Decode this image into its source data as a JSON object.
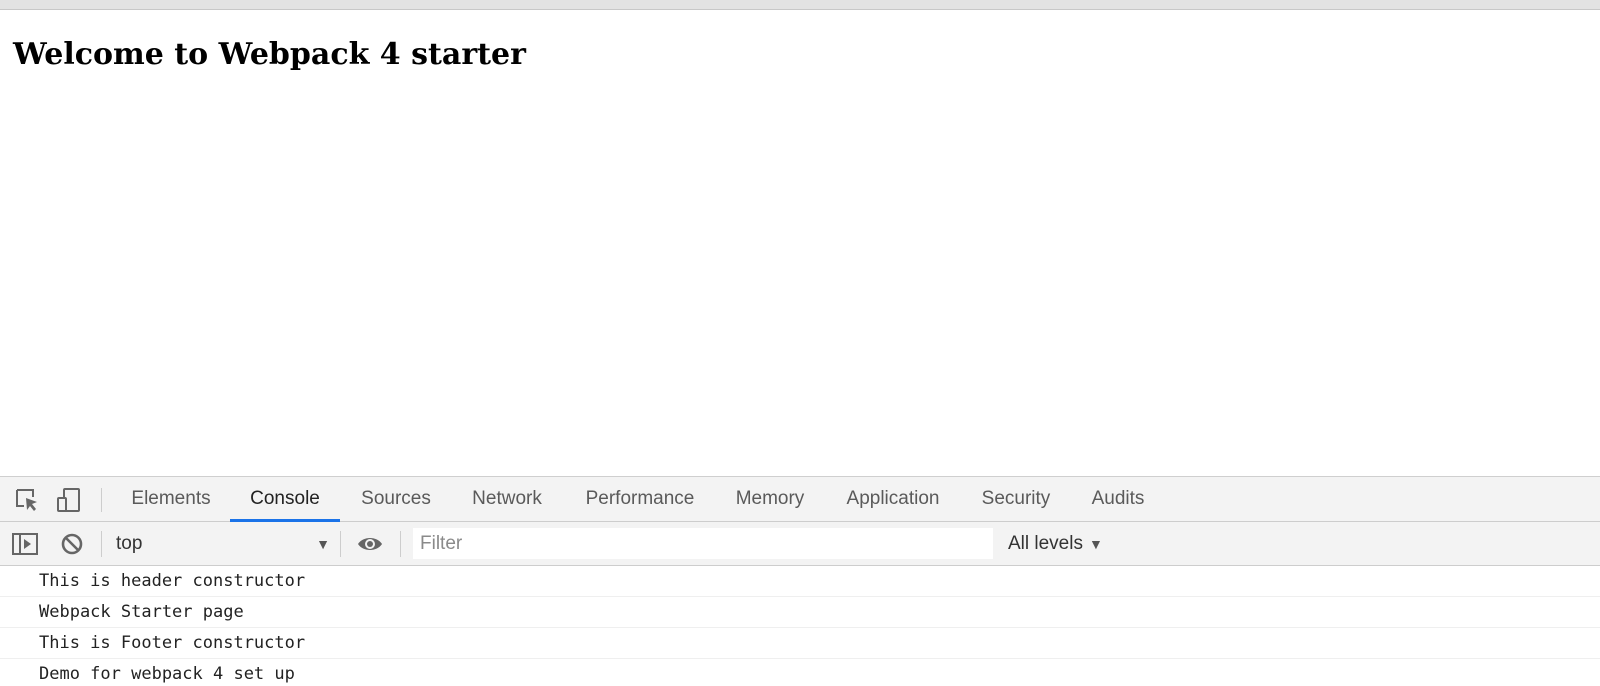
{
  "page": {
    "heading": "Welcome to Webpack 4 starter"
  },
  "devtools": {
    "tabs": [
      {
        "label": "Elements",
        "active": false
      },
      {
        "label": "Console",
        "active": true
      },
      {
        "label": "Sources",
        "active": false
      },
      {
        "label": "Network",
        "active": false
      },
      {
        "label": "Performance",
        "active": false
      },
      {
        "label": "Memory",
        "active": false
      },
      {
        "label": "Application",
        "active": false
      },
      {
        "label": "Security",
        "active": false
      },
      {
        "label": "Audits",
        "active": false
      }
    ],
    "toolbar_icons": [
      "inspect-element-icon",
      "device-toolbar-icon"
    ],
    "accent_color": "#1a73e8"
  },
  "console": {
    "toolbar_icons": [
      "sidebar-toggle-icon",
      "clear-console-icon",
      "live-expression-eye-icon"
    ],
    "context": "top",
    "filter": {
      "value": "",
      "placeholder": "Filter"
    },
    "levels": "All levels",
    "messages": [
      "This is header constructor",
      "Webpack Starter page",
      "This is Footer constructor",
      "Demo for webpack 4 set up"
    ]
  }
}
